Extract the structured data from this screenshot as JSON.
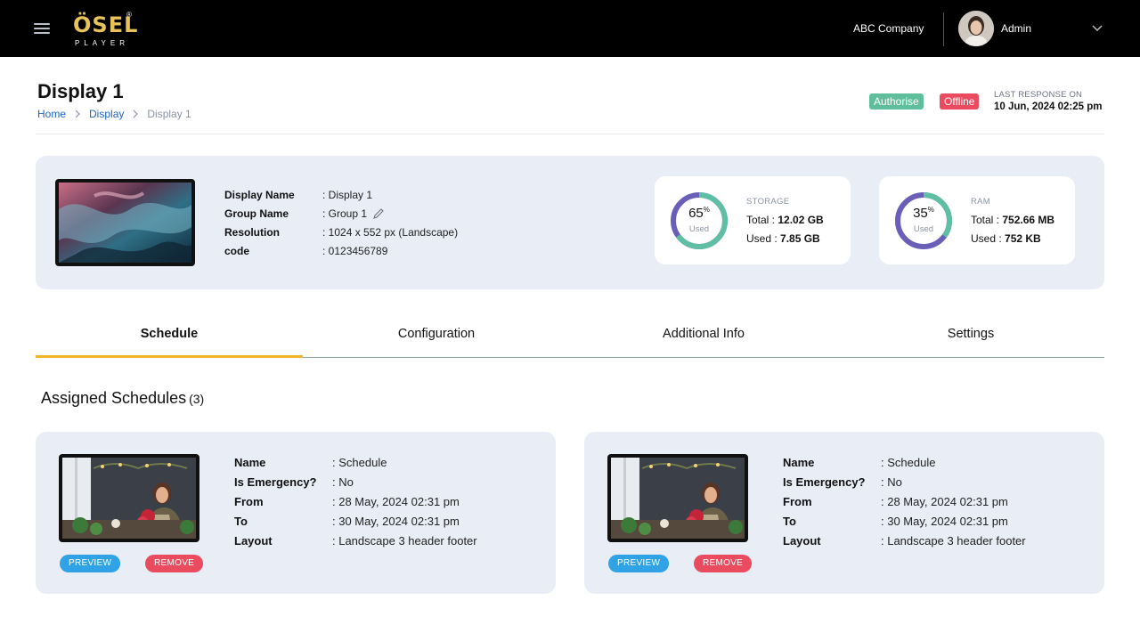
{
  "header": {
    "logo_text": "ÖSEL",
    "logo_reg": "®",
    "logo_sub": "PLAYER",
    "company": "ABC Company",
    "user_name": "Admin"
  },
  "page": {
    "title": "Display 1",
    "breadcrumb": [
      "Home",
      "Display",
      "Display 1"
    ],
    "badges": {
      "authorise": "Authorise",
      "offline": "Offline"
    },
    "last_response_label": "LAST RESPONSE ON",
    "last_response_value": "10 Jun, 2024 02:25 pm"
  },
  "display_info": {
    "rows": [
      {
        "label": "Display Name",
        "value": ": Display 1"
      },
      {
        "label": "Group Name",
        "value": ": Group 1"
      },
      {
        "label": "Resolution",
        "value": ":  1024 x 552 px (Landscape)"
      },
      {
        "label": "code",
        "value": ":  0123456789"
      }
    ]
  },
  "storage": {
    "title": "STORAGE",
    "percent": "65",
    "percent_value": 65,
    "used_label": "Used",
    "total_label": "Total : ",
    "total_value": "12.02 GB",
    "usedline_label": "Used : ",
    "used_value": "7.85 GB"
  },
  "ram": {
    "title": "RAM",
    "percent": "35",
    "percent_value": 35,
    "used_label": "Used",
    "total_label": "Total : ",
    "total_value": "752.66 MB",
    "usedline_label": "Used : ",
    "used_value": "752 KB"
  },
  "tabs": [
    "Schedule",
    "Configuration",
    "Additional Info",
    "Settings"
  ],
  "assigned": {
    "title": "Assigned Schedules",
    "count": "(3)"
  },
  "schedules": [
    {
      "rows": [
        {
          "label": "Name",
          "value": ": Schedule"
        },
        {
          "label": "Is Emergency?",
          "value": ": No"
        },
        {
          "label": "From",
          "value": ":  28 May, 2024 02:31 pm"
        },
        {
          "label": "To",
          "value": ":  30 May, 2024 02:31 pm"
        },
        {
          "label": "Layout",
          "value": ":  Landscape 3 header footer"
        }
      ],
      "preview_label": "PREVIEW",
      "remove_label": "REMOVE"
    },
    {
      "rows": [
        {
          "label": "Name",
          "value": ": Schedule"
        },
        {
          "label": "Is Emergency?",
          "value": ": No"
        },
        {
          "label": "From",
          "value": ":  28 May, 2024 02:31 pm"
        },
        {
          "label": "To",
          "value": ":  30 May, 2024 02:31 pm"
        },
        {
          "label": "Layout",
          "value": ":  Landscape 3 header footer"
        }
      ],
      "preview_label": "PREVIEW",
      "remove_label": "REMOVE"
    }
  ],
  "colors": {
    "accent_tab": "#f0b429",
    "ring_storage": "#5fbfa5",
    "ring_ram": "#6a5fb8",
    "badge_green": "#5fbf9d",
    "badge_red": "#ea4b5e",
    "preview_blue": "#2fa3e6"
  }
}
